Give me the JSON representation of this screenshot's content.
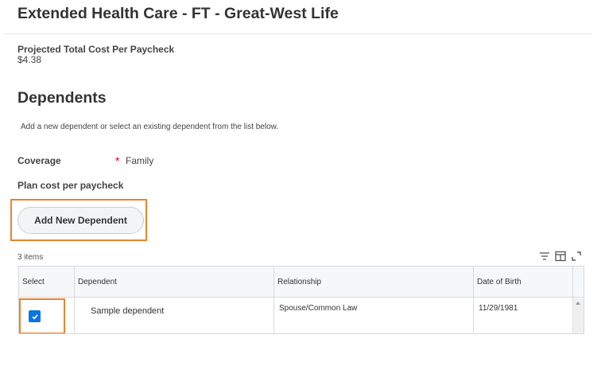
{
  "page": {
    "title": "Extended Health Care - FT - Great-West Life"
  },
  "projected": {
    "label": "Projected Total Cost Per Paycheck",
    "value": "$4.38"
  },
  "dependents": {
    "title": "Dependents",
    "instructions": "Add a new dependent or select an existing dependent from the list below."
  },
  "coverage": {
    "label": "Coverage",
    "required_marker": "*",
    "value": "Family"
  },
  "plan_cost": {
    "label": "Plan cost per paycheck"
  },
  "add_button": {
    "label": "Add New Dependent"
  },
  "table": {
    "count_text": "3 items",
    "toolbar_icons": [
      "filter-icon",
      "columns-icon",
      "expand-icon"
    ],
    "columns": [
      "Select",
      "Dependent",
      "Relationship",
      "Date of Birth"
    ],
    "rows": [
      {
        "selected": true,
        "dependent": "Sample dependent",
        "relationship": "Spouse/Common Law",
        "date_of_birth": "11/29/1981"
      }
    ]
  },
  "colors": {
    "accent": "#0875e1",
    "highlight": "#e8842d",
    "required": "#d0021b"
  }
}
